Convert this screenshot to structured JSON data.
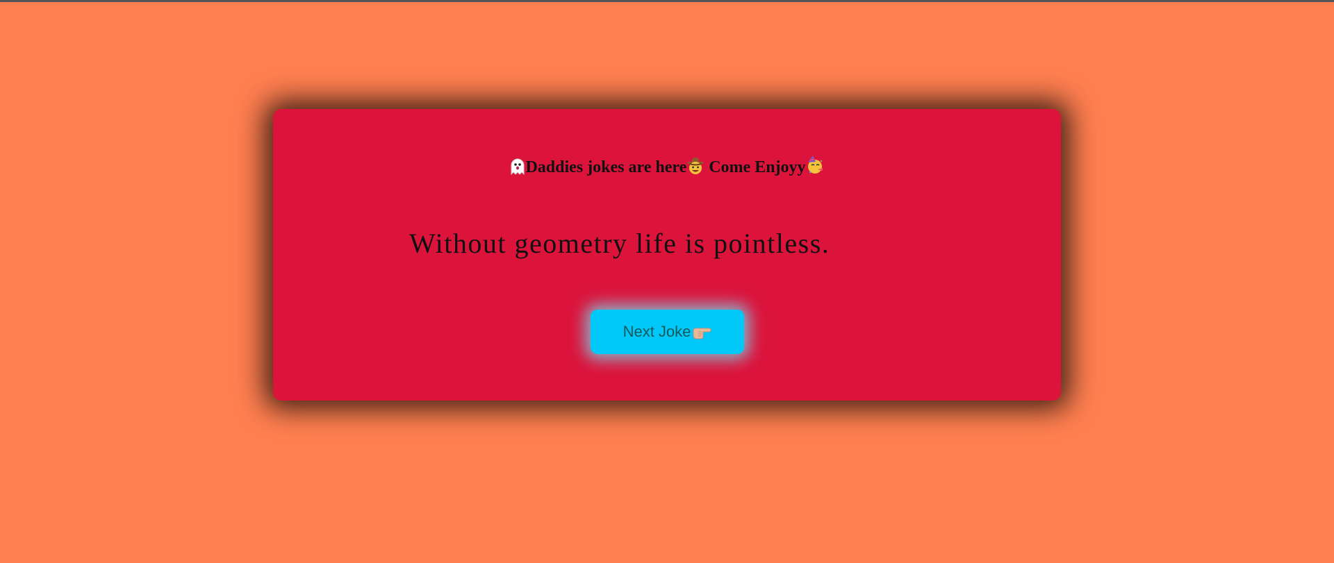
{
  "page": {
    "background_color": "#ff7f50",
    "card_color": "#dc143c",
    "button_color": "#00c8f8"
  },
  "header": {
    "leading_icon": "ghost-icon",
    "title_part1": "Daddies jokes are here",
    "middle_icon": "cowboy-face-icon",
    "title_part2": " Come Enjoyy",
    "trailing_icon": "partying-face-icon"
  },
  "joke": {
    "text": "Without geometry life is pointless."
  },
  "button": {
    "label": "Next Joke",
    "icon": "pointing-right-icon"
  }
}
